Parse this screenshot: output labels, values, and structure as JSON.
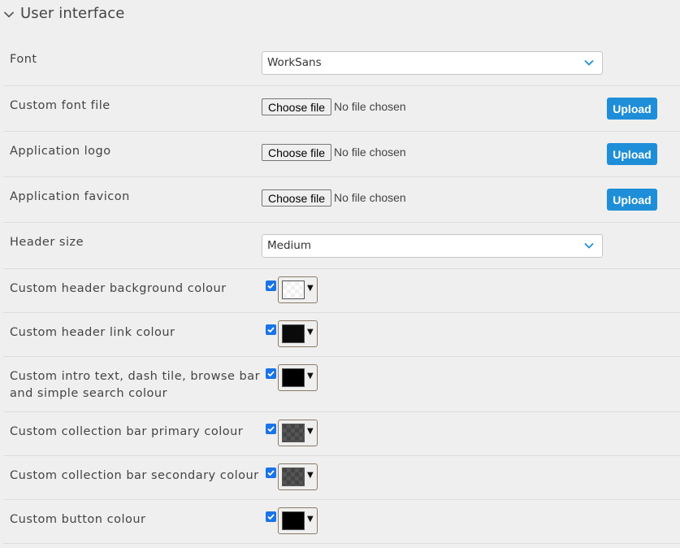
{
  "section": {
    "title": "User interface"
  },
  "font_row": {
    "label": "Font",
    "selected": "WorkSans"
  },
  "upload_rows": [
    {
      "label": "Custom font file",
      "choose_label": "Choose file",
      "status": "No file chosen",
      "upload_label": "Upload"
    },
    {
      "label": "Application logo",
      "choose_label": "Choose file",
      "status": "No file chosen",
      "upload_label": "Upload"
    },
    {
      "label": "Application favicon",
      "choose_label": "Choose file",
      "status": "No file chosen",
      "upload_label": "Upload"
    }
  ],
  "header_size_row": {
    "label": "Header size",
    "selected": "Medium"
  },
  "colour_rows": [
    {
      "label": "Custom header background colour",
      "checked": true,
      "colour": "#ffffff"
    },
    {
      "label": "Custom header link colour",
      "checked": true,
      "colour": "#0a0a0a"
    },
    {
      "label_line1": "Custom intro text, dash tile, browse bar",
      "label_line2": "and simple search colour",
      "checked": true,
      "colour": "#000000"
    },
    {
      "label": "Custom collection bar primary colour",
      "checked": true,
      "colour": "#444444"
    },
    {
      "label": "Custom collection bar secondary colour",
      "checked": true,
      "colour": "#444444"
    },
    {
      "label": "Custom button colour",
      "checked": true,
      "colour": "#000000"
    }
  ],
  "theme": {
    "accent": "#1f8ed8",
    "checkbox": "#1a73e8",
    "background": "#efefef"
  }
}
